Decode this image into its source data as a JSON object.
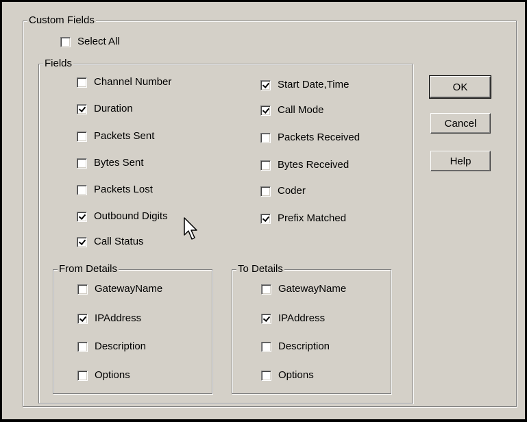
{
  "custom_fields": {
    "title": "Custom Fields",
    "select_all": {
      "label": "Select All",
      "checked": false
    }
  },
  "fields": {
    "title": "Fields",
    "left": [
      {
        "label": "Channel Number",
        "checked": false
      },
      {
        "label": "Duration",
        "checked": true
      },
      {
        "label": "Packets Sent",
        "checked": false
      },
      {
        "label": "Bytes Sent",
        "checked": false
      },
      {
        "label": "Packets Lost",
        "checked": false
      },
      {
        "label": "Outbound Digits",
        "checked": true
      },
      {
        "label": "Call Status",
        "checked": true
      }
    ],
    "right": [
      {
        "label": "Start Date,Time",
        "checked": true
      },
      {
        "label": "Call Mode",
        "checked": true
      },
      {
        "label": "Packets Received",
        "checked": false
      },
      {
        "label": "Bytes Received",
        "checked": false
      },
      {
        "label": "Coder",
        "checked": false
      },
      {
        "label": "Prefix Matched",
        "checked": true
      }
    ]
  },
  "from_details": {
    "title": "From Details",
    "items": [
      {
        "label": "GatewayName",
        "checked": false
      },
      {
        "label": "IPAddress",
        "checked": true
      },
      {
        "label": "Description",
        "checked": false
      },
      {
        "label": "Options",
        "checked": false
      }
    ]
  },
  "to_details": {
    "title": "To Details",
    "items": [
      {
        "label": "GatewayName",
        "checked": false
      },
      {
        "label": "IPAddress",
        "checked": true
      },
      {
        "label": "Description",
        "checked": false
      },
      {
        "label": "Options",
        "checked": false
      }
    ]
  },
  "buttons": {
    "ok": "OK",
    "cancel": "Cancel",
    "help": "Help"
  }
}
